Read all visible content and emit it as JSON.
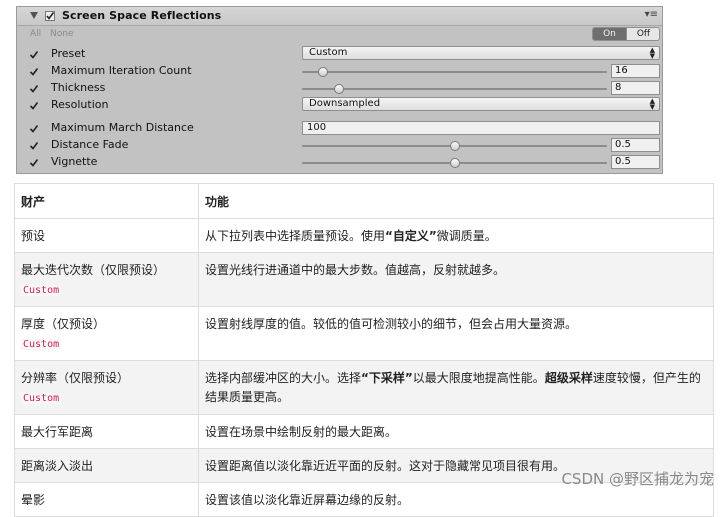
{
  "inspector": {
    "title": "Screen Space Reflections",
    "all_label": "All",
    "none_label": "None",
    "on_label": "On",
    "off_label": "Off",
    "rows": [
      {
        "label": "Preset",
        "control": "dropdown",
        "value": "Custom",
        "checked": true
      },
      {
        "label": "Maximum Iteration Count",
        "control": "slider",
        "value": "16",
        "slider_fraction": 0.07,
        "checked": true
      },
      {
        "label": "Thickness",
        "control": "slider",
        "value": "8",
        "slider_fraction": 0.12,
        "checked": true
      },
      {
        "label": "Resolution",
        "control": "dropdown",
        "value": "Downsampled",
        "checked": true
      },
      {
        "label": "Maximum March Distance",
        "control": "text",
        "value": "100",
        "checked": true
      },
      {
        "label": "Distance Fade",
        "control": "slider",
        "value": "0.5",
        "slider_fraction": 0.5,
        "checked": true
      },
      {
        "label": "Vignette",
        "control": "slider",
        "value": "0.5",
        "slider_fraction": 0.5,
        "checked": true
      }
    ]
  },
  "table": {
    "headers": [
      "财产",
      "功能"
    ],
    "rows": [
      {
        "property": "预设",
        "tag": "",
        "desc_parts": [
          {
            "t": "从下拉列表中选择质量预设。使用"
          },
          {
            "t": "“自定义”",
            "b": true
          },
          {
            "t": "微调质量。"
          }
        ]
      },
      {
        "property": "最大迭代次数（仅限预设）",
        "tag": "Custom",
        "desc_parts": [
          {
            "t": "设置光线行进通道中的最大步数。值越高，反射就越多。"
          }
        ]
      },
      {
        "property": "厚度（仅预设）",
        "tag": "Custom",
        "desc_parts": [
          {
            "t": "设置射线厚度的值。较低的值可检测较小的细节，但会占用大量资源。"
          }
        ]
      },
      {
        "property": "分辨率（仅限预设）",
        "tag": "Custom",
        "desc_parts": [
          {
            "t": "选择内部缓冲区的大小。选择"
          },
          {
            "t": "“下采样”",
            "b": true
          },
          {
            "t": "以最大限度地提高性能。"
          },
          {
            "t": "超级采样",
            "b": true
          },
          {
            "t": "速度较慢，但产生的结果质量更高。"
          }
        ]
      },
      {
        "property": "最大行军距离",
        "tag": "",
        "desc_parts": [
          {
            "t": "设置在场景中绘制反射的最大距离。"
          }
        ]
      },
      {
        "property": "距离淡入淡出",
        "tag": "",
        "desc_parts": [
          {
            "t": "设置距离值以淡化靠近近平面的反射。这对于隐藏常见项目很有用。"
          }
        ]
      },
      {
        "property": "晕影",
        "tag": "",
        "desc_parts": [
          {
            "t": "设置该值以淡化靠近屏幕边缘的反射。"
          }
        ]
      }
    ]
  },
  "watermark": "CSDN @野区捕龙为宠"
}
